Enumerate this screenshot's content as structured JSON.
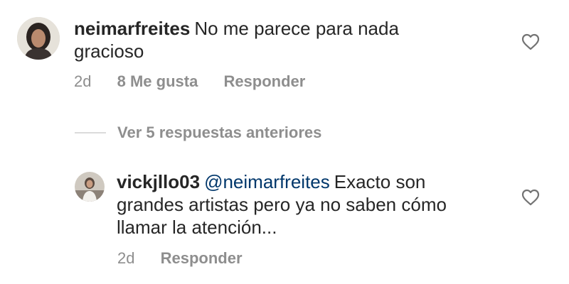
{
  "comments": [
    {
      "username": "neimarfreites",
      "text": "No me parece para nada gracioso",
      "time": "2d",
      "likes": "8 Me gusta",
      "reply_label": "Responder"
    }
  ],
  "replies_toggle": {
    "label": "Ver 5 respuestas anteriores"
  },
  "reply": {
    "username": "vickjllo03",
    "mention": "@neimarfreites",
    "text": "Exacto son grandes artistas pero ya no saben cómo llamar la atención...",
    "time": "2d",
    "reply_label": "Responder"
  },
  "icons": {
    "like": "heart-outline-icon"
  },
  "colors": {
    "text": "#262626",
    "muted": "#8e8e8e",
    "mention": "#00376b",
    "divider": "#dbdbdb"
  }
}
